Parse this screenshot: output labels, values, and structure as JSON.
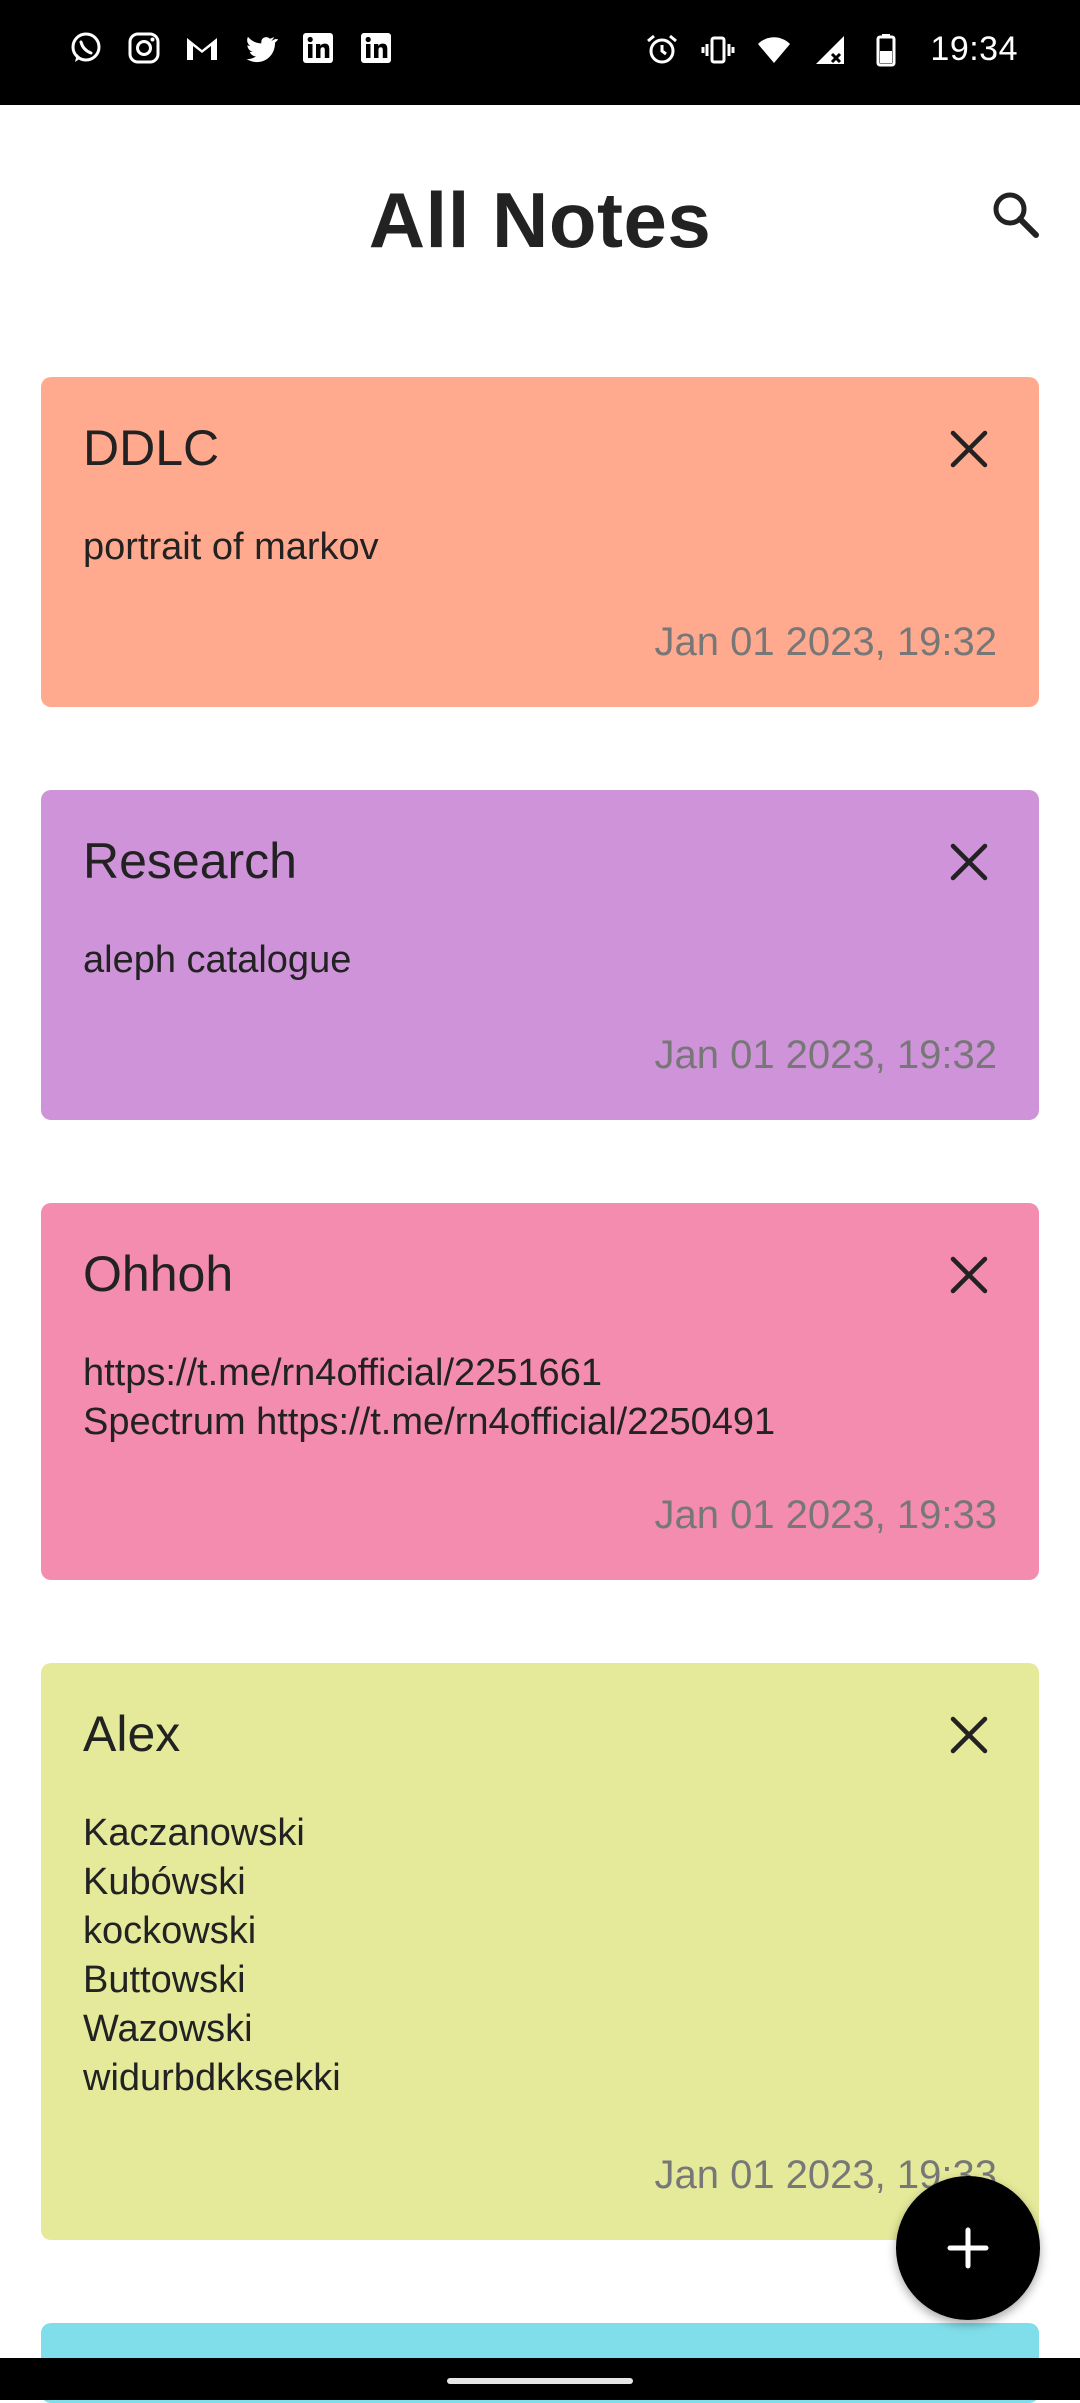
{
  "status_bar": {
    "time": "19:34",
    "left_icons": [
      "whatsapp-icon",
      "instagram-icon",
      "gmail-icon",
      "twitter-icon",
      "linkedin-icon",
      "linkedin-icon"
    ],
    "right_icons": [
      "alarm-icon",
      "vibrate-icon",
      "wifi-icon",
      "signal-icon",
      "battery-icon"
    ]
  },
  "header": {
    "title": "All Notes",
    "search_icon": "search-icon"
  },
  "notes": [
    {
      "title": "DDLC",
      "body": "portrait of markov",
      "date": "Jan 01 2023, 19:32",
      "color": "#FFAA8F"
    },
    {
      "title": "Research",
      "body": "aleph catalogue",
      "date": "Jan 01 2023, 19:32",
      "color": "#CF93DA"
    },
    {
      "title": "Ohhoh",
      "body": "https://t.me/rn4official/2251661\nSpectrum https://t.me/rn4official/2250491",
      "date": "Jan 01 2023, 19:33",
      "color": "#F48CB0"
    },
    {
      "title": "Alex",
      "body": "Kaczanowski\nKubówski\nkockowski\nButtowski\nWazowski\nwidurbdkksekki",
      "date": "Jan 01 2023, 19:33",
      "color": "#E5EA9A"
    },
    {
      "title": "",
      "body": "",
      "date": "",
      "color": "#80DEEA"
    }
  ],
  "fab": {
    "icon": "plus-icon"
  }
}
